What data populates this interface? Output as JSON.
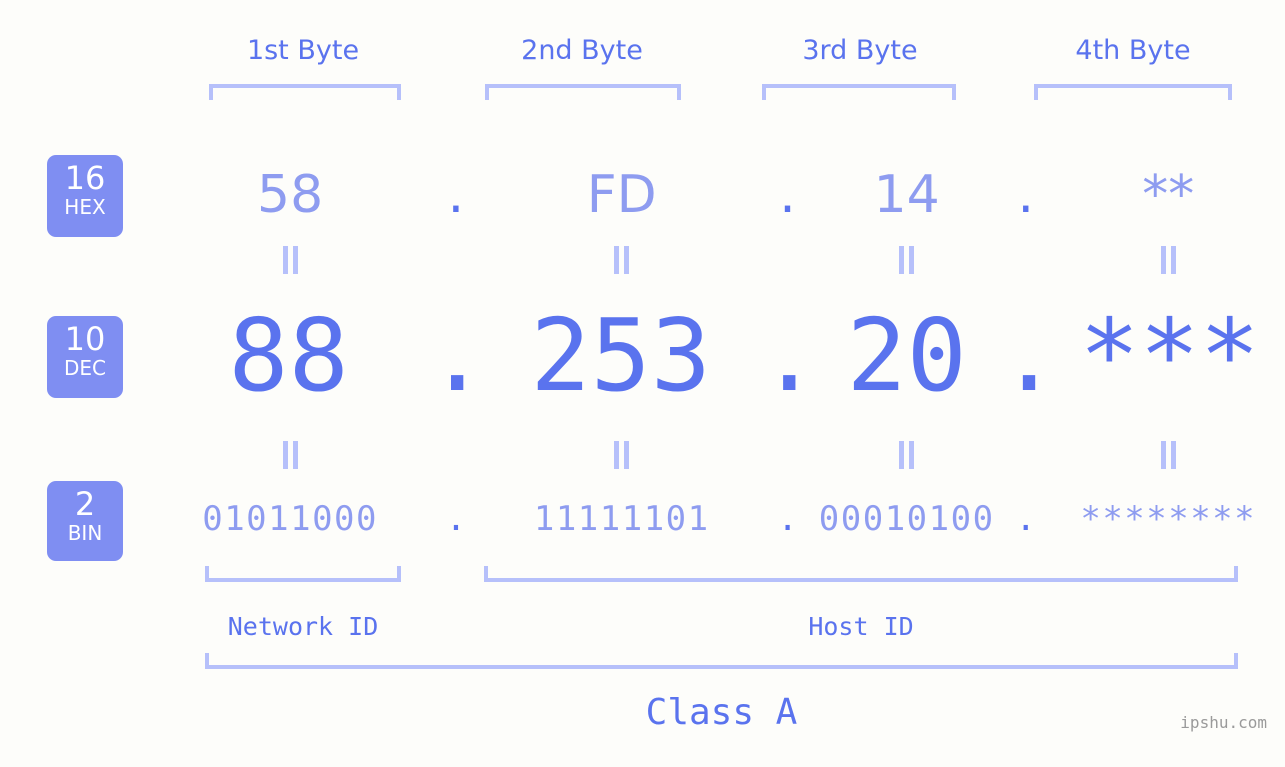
{
  "background_color": "#fdfdfa",
  "accent_colors": {
    "strong_blue": "#5a73ee",
    "light_blue": "#8e9cf0",
    "bracket_blue": "#b6c0fa",
    "badge_bg": "#7f8ef2",
    "badge_text": "#ffffff",
    "watermark_gray": "#9a9a9a"
  },
  "byte_headers": [
    {
      "label": "1st Byte"
    },
    {
      "label": "2nd Byte"
    },
    {
      "label": "3rd Byte"
    },
    {
      "label": "4th Byte"
    }
  ],
  "rows": {
    "hex": {
      "badge_number": "16",
      "badge_system": "HEX",
      "separator": ".",
      "values": [
        "58",
        "FD",
        "14",
        "**"
      ]
    },
    "dec": {
      "badge_number": "10",
      "badge_system": "DEC",
      "separator": ".",
      "values": [
        "88",
        "253",
        "20",
        "***"
      ]
    },
    "bin": {
      "badge_number": "2",
      "badge_system": "BIN",
      "separator": ".",
      "values": [
        "01011000",
        "11111101",
        "00010100",
        "********"
      ]
    }
  },
  "equality_marks": {
    "glyph": "||",
    "count_per_row": 4
  },
  "sections": {
    "network_id_label": "Network ID",
    "host_id_label": "Host ID",
    "class_label": "Class A"
  },
  "watermark": "ipshu.com"
}
